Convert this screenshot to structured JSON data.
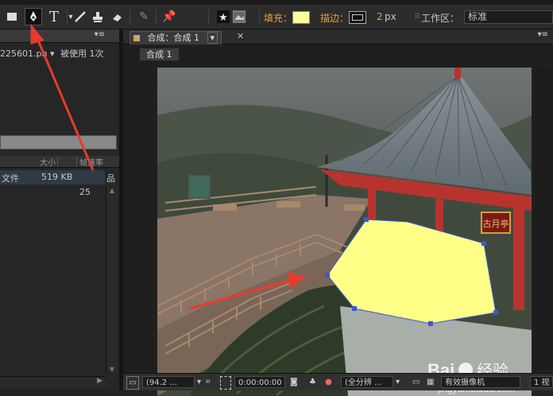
{
  "toolbar": {
    "fill_label": "填充：",
    "stroke_label": "描边：",
    "stroke_width": "2",
    "stroke_unit": "px",
    "workspace_label": "工作区：",
    "workspace_value": "标准",
    "fill_color": "#ffff99"
  },
  "project_panel": {
    "filename": "225601.pn",
    "usage": "被使用 1次",
    "col_size": "大小",
    "col_rate": "帧速率",
    "row_type": "文件",
    "row_size": "519 KB",
    "row_rate": "25"
  },
  "comp_panel": {
    "tab_label": "合成：合成 1",
    "breadcrumb": "合成 1"
  },
  "status_bar": {
    "zoom": "(94.2 ...",
    "timecode": "0:00:00:00",
    "resolution": "(全分辨 ...",
    "camera": "有效摄像机",
    "view_count": "1 视"
  },
  "watermark": {
    "brand": "Bai",
    "brand2": "经验",
    "url": "jingyan.baidu.com"
  },
  "pavilion_sign": "古月亭",
  "colors": {
    "accent": "#e8a03a",
    "shape_fill": "#ffff88",
    "arrow": "#e83a2e",
    "selection": "#3a5acc"
  }
}
